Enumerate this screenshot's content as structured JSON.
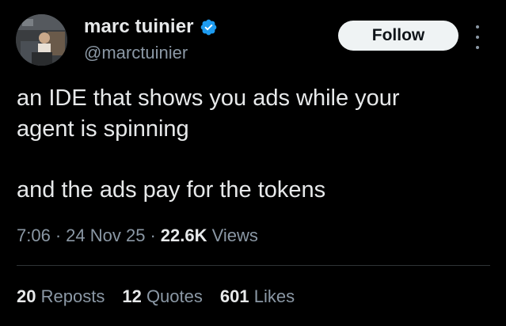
{
  "author": {
    "display_name": "marc tuinier",
    "handle": "@marctuinier",
    "verified_icon": "verified-badge-icon",
    "avatar_icon": "profile-photo"
  },
  "actions": {
    "follow_label": "Follow",
    "more_icon": "more-options-icon"
  },
  "tweet": {
    "line1": "an IDE that shows you ads while your",
    "line2": "agent is spinning",
    "line3": "and the ads pay for the tokens"
  },
  "meta": {
    "time": "7:06",
    "date": "24 Nov 25",
    "views_count": "22.6K",
    "views_label": "Views"
  },
  "stats": {
    "reposts_count": "20",
    "reposts_label": "Reposts",
    "quotes_count": "12",
    "quotes_label": "Quotes",
    "likes_count": "601",
    "likes_label": "Likes"
  },
  "colors": {
    "background": "#000000",
    "primary_text": "#e7e9ea",
    "secondary_text": "#8b98a5",
    "verified_blue": "#1d9bf0",
    "follow_bg": "#eff3f4"
  }
}
